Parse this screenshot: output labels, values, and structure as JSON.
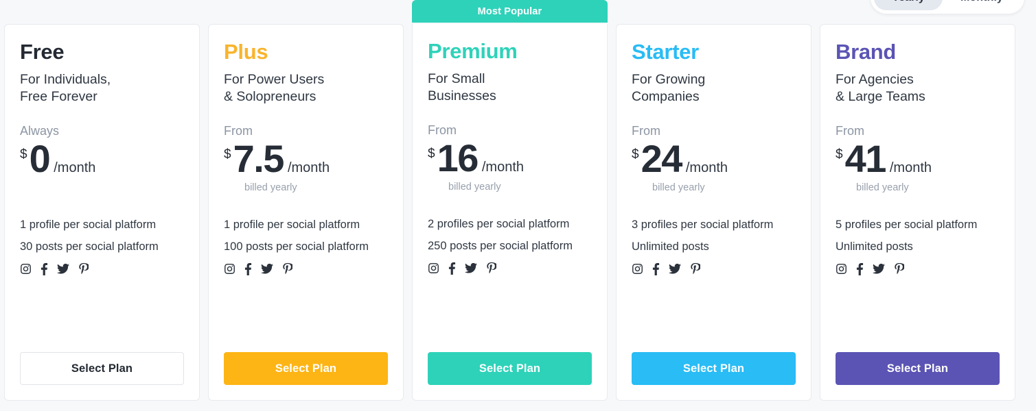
{
  "billing_toggle": {
    "options": [
      {
        "label": "Yearly",
        "active": true
      },
      {
        "label": "Monthly",
        "active": false
      }
    ]
  },
  "badge": {
    "most_popular": "Most Popular"
  },
  "colors": {
    "free": "#242a33",
    "plus": "#f9b42d",
    "premium": "#2ed2b9",
    "starter": "#29bcf5",
    "brand": "#5b54b4",
    "page_background": "#f7f8fa",
    "card_background": "#ffffff",
    "card_border": "#e8eaee"
  },
  "social_icons": [
    "instagram-icon",
    "facebook-icon",
    "twitter-icon",
    "pinterest-icon"
  ],
  "plans": [
    {
      "name": "Free",
      "name_color": "#242a33",
      "tagline": "For Individuals,\nFree Forever",
      "price_prefix": "Always",
      "currency": "$",
      "amount": "0",
      "period": "/month",
      "billed_note": "",
      "features": [
        "1 profile per social platform",
        "30 posts per social platform"
      ],
      "cta_label": "Select Plan",
      "cta_style": "outline",
      "cta_color": "#ffffff",
      "featured": false
    },
    {
      "name": "Plus",
      "name_color": "#f9b42d",
      "tagline": "For Power Users\n& Solopreneurs",
      "price_prefix": "From",
      "currency": "$",
      "amount": "7.5",
      "period": "/month",
      "billed_note": "billed yearly",
      "features": [
        "1 profile per social platform",
        "100 posts per social platform"
      ],
      "cta_label": "Select Plan",
      "cta_style": "solid",
      "cta_color": "#fdb515",
      "featured": false
    },
    {
      "name": "Premium",
      "name_color": "#2ed2b9",
      "tagline": "For Small\nBusinesses",
      "price_prefix": "From",
      "currency": "$",
      "amount": "16",
      "period": "/month",
      "billed_note": "billed yearly",
      "features": [
        "2 profiles per social platform",
        "250 posts per social platform"
      ],
      "cta_label": "Select Plan",
      "cta_style": "solid",
      "cta_color": "#2ed2b9",
      "featured": true,
      "badge": "Most Popular"
    },
    {
      "name": "Starter",
      "name_color": "#29bcf5",
      "tagline": "For Growing\nCompanies",
      "price_prefix": "From",
      "currency": "$",
      "amount": "24",
      "period": "/month",
      "billed_note": "billed yearly",
      "features": [
        "3 profiles per social platform",
        "Unlimited posts"
      ],
      "cta_label": "Select Plan",
      "cta_style": "solid",
      "cta_color": "#29bcf5",
      "featured": false
    },
    {
      "name": "Brand",
      "name_color": "#5b54b4",
      "tagline": "For Agencies\n& Large Teams",
      "price_prefix": "From",
      "currency": "$",
      "amount": "41",
      "period": "/month",
      "billed_note": "billed yearly",
      "features": [
        "5 profiles per social platform",
        "Unlimited posts"
      ],
      "cta_label": "Select Plan",
      "cta_style": "solid",
      "cta_color": "#5b54b4",
      "featured": false
    }
  ]
}
